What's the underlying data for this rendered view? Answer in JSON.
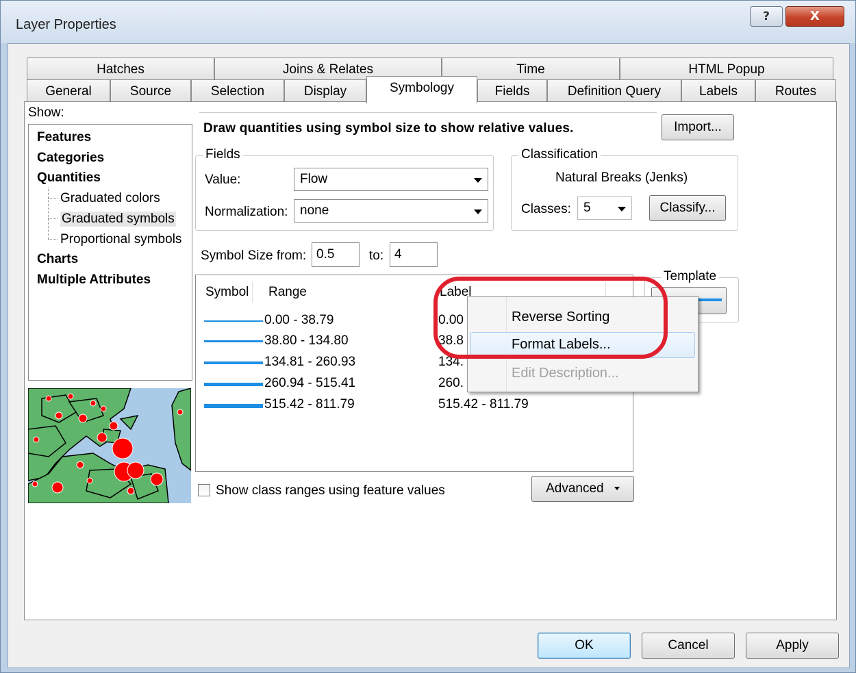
{
  "window": {
    "title": "Layer Properties",
    "help_label": "?",
    "close_label": "X"
  },
  "tabs": {
    "row1": [
      "Hatches",
      "Joins & Relates",
      "Time",
      "HTML Popup"
    ],
    "row2": [
      "General",
      "Source",
      "Selection",
      "Display",
      "Symbology",
      "Fields",
      "Definition Query",
      "Labels",
      "Routes"
    ],
    "active": "Symbology"
  },
  "show": {
    "label": "Show:",
    "items": [
      "Features",
      "Categories",
      "Quantities"
    ],
    "sub_items": [
      "Graduated colors",
      "Graduated symbols",
      "Proportional symbols"
    ],
    "selected": "Graduated symbols",
    "more_items": [
      "Charts",
      "Multiple Attributes"
    ]
  },
  "description": "Draw quantities using symbol size to show relative values.",
  "import_button": "Import...",
  "fields": {
    "group_label": "Fields",
    "value_label": "Value:",
    "value": "Flow",
    "normalization_label": "Normalization:",
    "normalization": "none"
  },
  "classification": {
    "group_label": "Classification",
    "method": "Natural Breaks (Jenks)",
    "classes_label": "Classes:",
    "classes": "5",
    "classify_button": "Classify..."
  },
  "symbol_size": {
    "from_label": "Symbol Size from:",
    "from": "0.5",
    "to_label": "to:",
    "to": "4"
  },
  "template": {
    "label": "Template"
  },
  "table": {
    "headers": {
      "symbol": "Symbol",
      "range": "Range",
      "label": "Label"
    },
    "rows": [
      {
        "range": "0.00 - 38.79",
        "label": "0.00"
      },
      {
        "range": "38.80 - 134.80",
        "label": "38.8"
      },
      {
        "range": "134.81 - 260.93",
        "label": "134."
      },
      {
        "range": "260.94 - 515.41",
        "label": "260."
      },
      {
        "range": "515.42 - 811.79",
        "label": "515.42 - 811.79"
      }
    ]
  },
  "context_menu": {
    "items": [
      "Reverse Sorting",
      "Format Labels...",
      "Edit Description..."
    ],
    "highlighted": "Format Labels...",
    "disabled": "Edit Description..."
  },
  "show_class_ranges": {
    "label": "Show class ranges using feature values",
    "checked": false
  },
  "advanced_button": "Advanced",
  "footer": {
    "ok": "OK",
    "cancel": "Cancel",
    "apply": "Apply"
  },
  "colors": {
    "accent": "#1e8fe5",
    "annotation_red": "#e0202e",
    "map_land": "#5fb56a",
    "map_water": "#a9cbe8",
    "map_dot": "#ff0000"
  }
}
